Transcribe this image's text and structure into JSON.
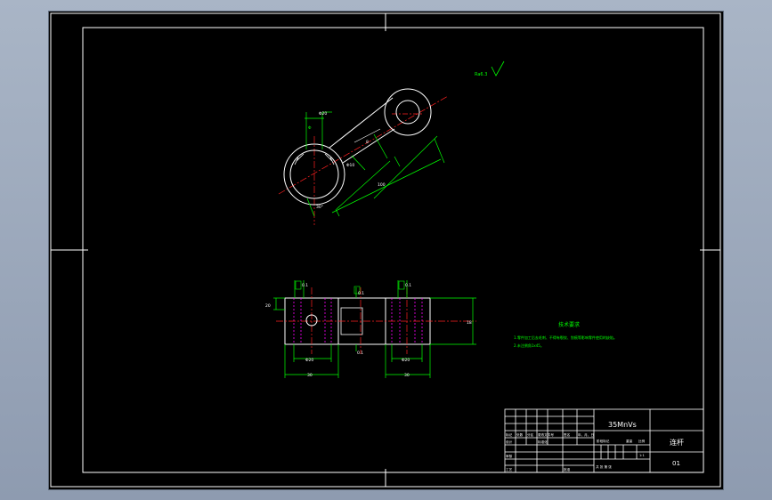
{
  "colors": {
    "background": "#000000",
    "frame": "#ffffff",
    "dimension": "#00ff00",
    "centerline": "#ff2020",
    "hidden_line": "#ff00ff",
    "text": "#ffffff"
  },
  "drawing": {
    "surface_roughness": "Ra6.3",
    "tech_requirements": {
      "title": "技术要求",
      "line1": "1.零件加工后去毛刺、不得有裂纹、划痕等影响零件使用的缺陷。",
      "line2": "2.未注倒角1x45。"
    },
    "dims_top": {
      "boss": "Φ20",
      "rib": "8",
      "length": "100",
      "hole": "Φ10",
      "angle": "30°"
    },
    "dims_bottom": {
      "tol_left": "0.1",
      "tol_mid": "0.1",
      "tol_right": "0.1",
      "height_left": "20",
      "height_right": "18",
      "bore_left": "Φ20",
      "bore_right": "Φ20",
      "width_left": "30",
      "width_right": "30",
      "flatness": "0.1"
    }
  },
  "title_block": {
    "material": "35MnVs",
    "part_name": "连杆",
    "drawing_no": "01",
    "row_labels": [
      "标记",
      "处数",
      "分区",
      "更改文件号",
      "签名",
      "年、月、日"
    ],
    "design_label": "设计",
    "standardize_label": "标准化",
    "stage_label": "阶段标记",
    "weight_label": "重量",
    "scale_label": "比例",
    "scale_value": "1:1",
    "review_label": "审核",
    "process_label": "工艺",
    "approve_label": "批准",
    "sheets_label": "共  张  第  张"
  }
}
